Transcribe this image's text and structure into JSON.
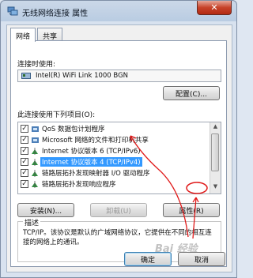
{
  "window": {
    "title": "无线网络连接 属性",
    "close_glyph": "✕"
  },
  "tabs": [
    {
      "label": "网络",
      "active": true
    },
    {
      "label": "共享",
      "active": false
    }
  ],
  "connect_using": {
    "label": "连接时使用:",
    "adapter": "Intel(R) WiFi Link 1000 BGN",
    "configure_button": "配置(C)..."
  },
  "items_section": {
    "label": "此连接使用下列项目(O):",
    "items": [
      {
        "label": "QoS 数据包计划程序",
        "checked": true,
        "icon": "qos-icon",
        "selected": false
      },
      {
        "label": "Microsoft 网络的文件和打印机共享",
        "checked": true,
        "icon": "file-share-icon",
        "selected": false
      },
      {
        "label": "Internet 协议版本 6 (TCP/IPv6)",
        "checked": true,
        "icon": "protocol-icon",
        "selected": false
      },
      {
        "label": "Internet 协议版本 4 (TCP/IPv4)",
        "checked": true,
        "icon": "protocol-icon",
        "selected": true
      },
      {
        "label": "链路层拓扑发现映射器 I/O 驱动程序",
        "checked": true,
        "icon": "protocol-icon",
        "selected": false
      },
      {
        "label": "链路层拓扑发现响应程序",
        "checked": true,
        "icon": "protocol-icon",
        "selected": false
      }
    ]
  },
  "buttons": {
    "install": "安装(N)...",
    "uninstall": "卸载(U)",
    "properties": "属性(R)",
    "ok": "确定",
    "cancel": "取消"
  },
  "description": {
    "title": "描述",
    "text": "TCP/IP。该协议是默认的广域网络协议，它提供在不同的相互连接的网络上的通讯。"
  },
  "watermark": "Bai 经验",
  "colors": {
    "selection": "#3399ff",
    "annotation_arrow": "#e01a1a"
  }
}
